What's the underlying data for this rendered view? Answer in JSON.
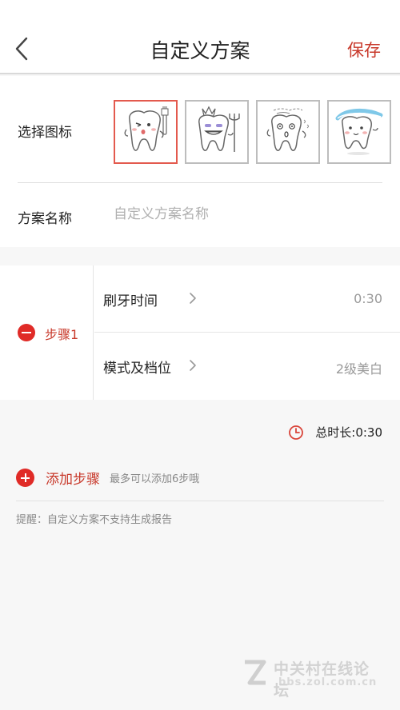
{
  "header": {
    "title": "自定义方案",
    "save_label": "保存",
    "back_icon": "chevron-left-icon"
  },
  "icon_picker": {
    "label": "选择图标",
    "options": [
      {
        "name": "tooth-with-toothbrush",
        "selected": true
      },
      {
        "name": "tooth-with-crown-and-trident",
        "selected": false
      },
      {
        "name": "tooth-dizzy",
        "selected": false
      },
      {
        "name": "tooth-with-toothpaste",
        "selected": false
      }
    ]
  },
  "plan_name": {
    "label": "方案名称",
    "placeholder": "自定义方案名称",
    "value": ""
  },
  "steps": [
    {
      "name": "步骤1",
      "brush_time_label": "刷牙时间",
      "brush_time_value": "0:30",
      "mode_label": "模式及档位",
      "mode_value": "2级美白"
    }
  ],
  "total": {
    "label": "总时长: ",
    "value": "0:30"
  },
  "add_step": {
    "label": "添加步骤",
    "hint": "最多可以添加6步哦"
  },
  "tip": "提醒：自定义方案不支持生成报告",
  "watermark": {
    "title": "中关村在线论坛",
    "url": "bbs.zol.com.cn"
  },
  "colors": {
    "accent": "#c8392b",
    "red_button": "#e02b27",
    "background": "#f7f7f7"
  }
}
